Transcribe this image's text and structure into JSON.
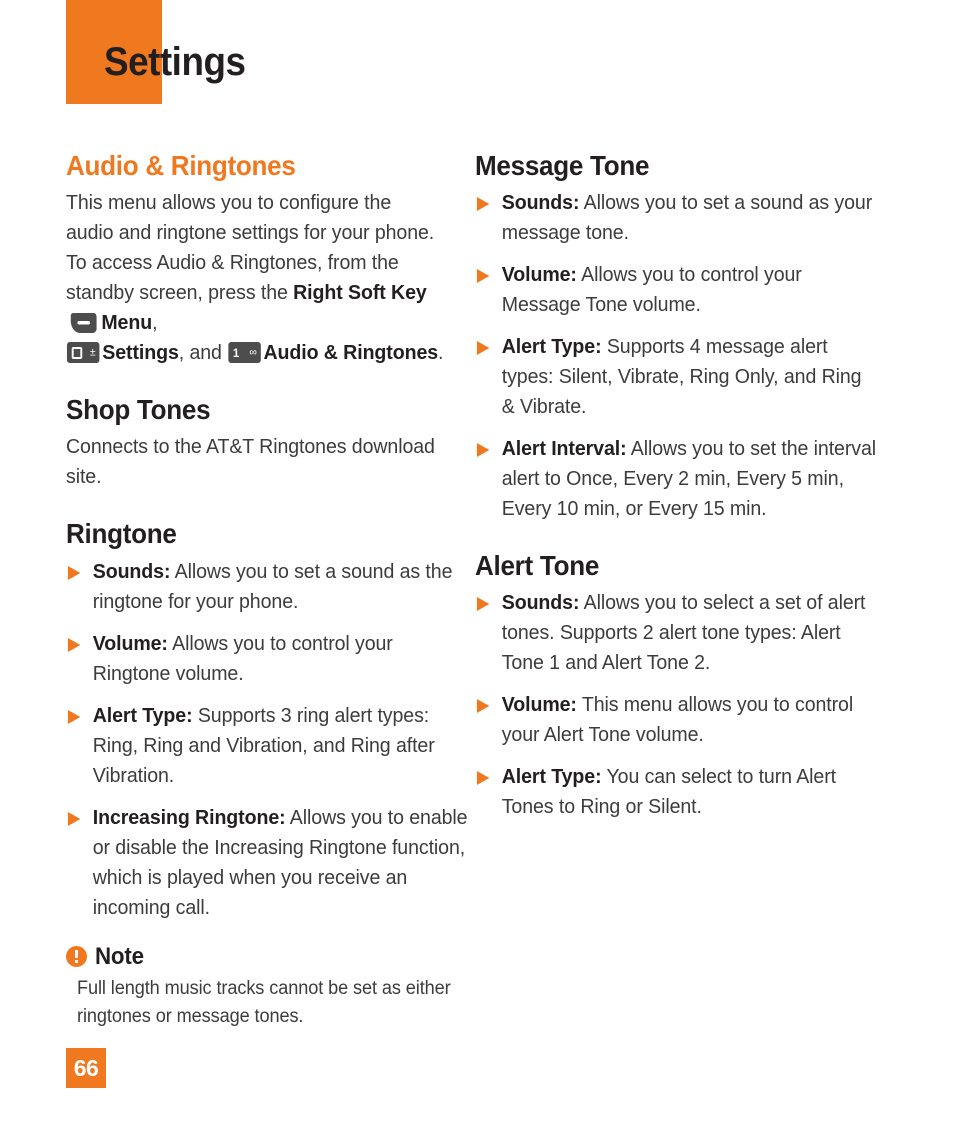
{
  "colors": {
    "accent": "#f0781f",
    "text": "#3c3c3c",
    "heading_dark": "#231f20",
    "keycap": "#4d4d4d"
  },
  "header": {
    "title": "Settings"
  },
  "footer": {
    "page_number": "66"
  },
  "left_column": {
    "section_title": "Audio & Ringtones",
    "intro": {
      "line1": "This menu allows you to configure the audio and ringtone settings for your phone.",
      "line2_a": "To access Audio & Ringtones, from the standby screen, press the ",
      "bold_right_soft_key": "Right Soft Key",
      "softkey_icon": "right-soft-key-icon",
      "bold_menu": "Menu",
      "comma1": ",",
      "key_zero_icon": "key-0-icon",
      "key_zero_num": "0",
      "key_zero_sym": "±",
      "bold_settings": "Settings",
      "and_text": ", and ",
      "key_one_icon": "key-1-icon",
      "key_one_num": "1",
      "key_one_sym": "∞",
      "bold_audio_ringtones": "Audio & Ringtones",
      "period": "."
    },
    "shop_tones": {
      "title": "Shop Tones",
      "body": "Connects to the AT&T Ringtones download site."
    },
    "ringtone": {
      "title": "Ringtone",
      "bullets": [
        {
          "term": "Sounds:",
          "text": " Allows you to set a sound as the ringtone for your phone."
        },
        {
          "term": "Volume:",
          "text": " Allows you to control your Ringtone volume."
        },
        {
          "term": "Alert Type:",
          "text": " Supports 3 ring alert types: Ring, Ring and Vibration, and Ring after Vibration."
        },
        {
          "term": "Increasing Ringtone:",
          "text": " Allows you to enable or disable the Increasing Ringtone function, which is played when you receive an incoming call."
        }
      ]
    },
    "note": {
      "icon": "note-exclamation-icon",
      "label": "Note",
      "body": "Full length music tracks cannot be set as either ringtones or message tones."
    }
  },
  "right_column": {
    "message_tone": {
      "title": "Message Tone",
      "bullets": [
        {
          "term": "Sounds:",
          "text": " Allows you to set a sound as your message tone."
        },
        {
          "term": "Volume:",
          "text": " Allows you to control your Message Tone volume."
        },
        {
          "term": "Alert Type:",
          "text": " Supports 4 message alert types: Silent, Vibrate, Ring Only, and Ring & Vibrate."
        },
        {
          "term": "Alert Interval:",
          "text": " Allows you to set the interval alert to Once, Every 2 min, Every 5 min, Every 10 min, or Every 15 min."
        }
      ]
    },
    "alert_tone": {
      "title": "Alert Tone",
      "bullets": [
        {
          "term": "Sounds:",
          "text": " Allows you to select a set of alert tones. Supports 2 alert tone types: Alert Tone 1 and Alert Tone 2."
        },
        {
          "term": "Volume:",
          "text": " This menu allows you to control your Alert Tone volume."
        },
        {
          "term": "Alert Type:",
          "text": " You can select to turn Alert Tones to Ring or Silent."
        }
      ]
    }
  }
}
